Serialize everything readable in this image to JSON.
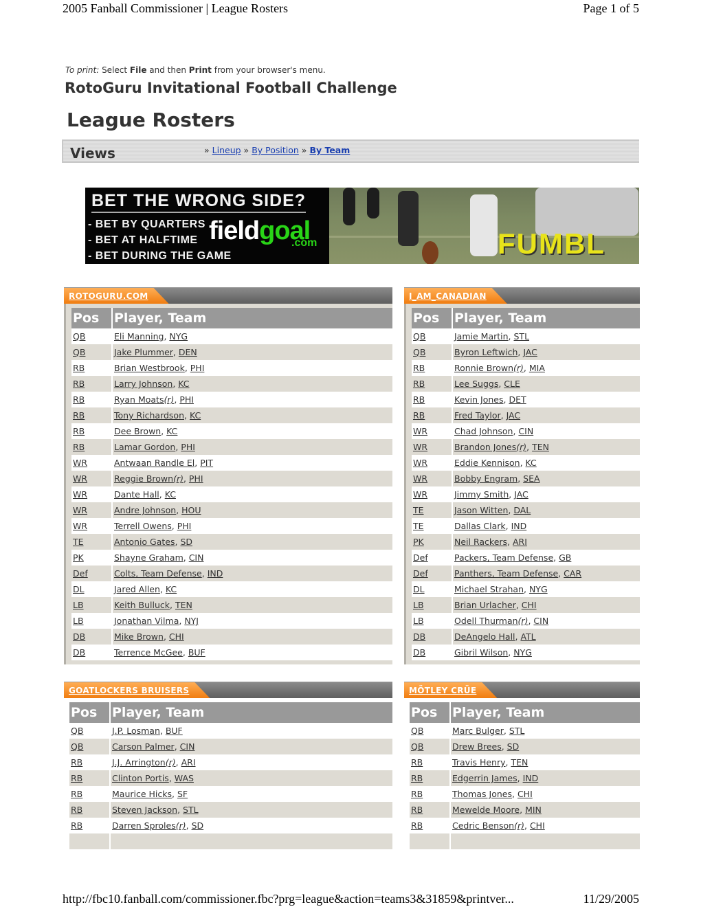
{
  "print_header": {
    "title": "2005 Fanball Commissioner | League Rosters",
    "page": "Page 1 of 5"
  },
  "print_footer": {
    "url": "http://fbc10.fanball.com/commissioner.fbc?prg=league&action=teams3&31859&printver...",
    "date": "11/29/2005"
  },
  "instructions": {
    "prefix": "To print:",
    "t1": " Select ",
    "file": "File",
    "t2": " and then ",
    "print": "Print",
    "t3": " from your browser's menu."
  },
  "league_name": "RotoGuru Invitational Football Challenge",
  "page_title": "League Rosters",
  "views": {
    "label": "Views",
    "sep": "»",
    "links": [
      {
        "label": "Lineup",
        "active": false
      },
      {
        "label": "By Position",
        "active": false
      },
      {
        "label": "By Team",
        "active": true
      }
    ]
  },
  "banner": {
    "headline": "BET THE WRONG SIDE?",
    "bullets": [
      "- BET BY QUARTERS",
      "- BET AT HALFTIME",
      "- BET DURING THE GAME"
    ],
    "logo_a": "field",
    "logo_b": "goal",
    "logo_c": ".com",
    "overlay": "FUMBL"
  },
  "columns": {
    "pos": "Pos",
    "player": "Player, Team"
  },
  "rookie_mark": "(r)",
  "teams": [
    {
      "name": "ROTOGURU.COM",
      "players": [
        {
          "pos": "QB",
          "name": "Eli Manning",
          "team": "NYG",
          "rookie": false
        },
        {
          "pos": "QB",
          "name": "Jake Plummer",
          "team": "DEN",
          "rookie": false
        },
        {
          "pos": "RB",
          "name": "Brian Westbrook",
          "team": "PHI",
          "rookie": false
        },
        {
          "pos": "RB",
          "name": "Larry Johnson",
          "team": "KC",
          "rookie": false
        },
        {
          "pos": "RB",
          "name": "Ryan Moats",
          "team": "PHI",
          "rookie": true
        },
        {
          "pos": "RB",
          "name": "Tony Richardson",
          "team": "KC",
          "rookie": false
        },
        {
          "pos": "RB",
          "name": "Dee Brown",
          "team": "KC",
          "rookie": false
        },
        {
          "pos": "RB",
          "name": "Lamar Gordon",
          "team": "PHI",
          "rookie": false
        },
        {
          "pos": "WR",
          "name": "Antwaan Randle El",
          "team": "PIT",
          "rookie": false
        },
        {
          "pos": "WR",
          "name": "Reggie Brown",
          "team": "PHI",
          "rookie": true
        },
        {
          "pos": "WR",
          "name": "Dante Hall",
          "team": "KC",
          "rookie": false
        },
        {
          "pos": "WR",
          "name": "Andre Johnson",
          "team": "HOU",
          "rookie": false
        },
        {
          "pos": "WR",
          "name": "Terrell Owens",
          "team": "PHI",
          "rookie": false
        },
        {
          "pos": "TE",
          "name": "Antonio Gates",
          "team": "SD",
          "rookie": false
        },
        {
          "pos": "PK",
          "name": "Shayne Graham",
          "team": "CIN",
          "rookie": false
        },
        {
          "pos": "Def",
          "name": "Colts, Team Defense",
          "team": "IND",
          "rookie": false
        },
        {
          "pos": "DL",
          "name": "Jared Allen",
          "team": "KC",
          "rookie": false
        },
        {
          "pos": "LB",
          "name": "Keith Bulluck",
          "team": "TEN",
          "rookie": false
        },
        {
          "pos": "LB",
          "name": "Jonathan Vilma",
          "team": "NYJ",
          "rookie": false
        },
        {
          "pos": "DB",
          "name": "Mike Brown",
          "team": "CHI",
          "rookie": false
        },
        {
          "pos": "DB",
          "name": "Terrence McGee",
          "team": "BUF",
          "rookie": false
        }
      ]
    },
    {
      "name": "I_AM_CANADIAN",
      "players": [
        {
          "pos": "QB",
          "name": "Jamie Martin",
          "team": "STL",
          "rookie": false
        },
        {
          "pos": "QB",
          "name": "Byron Leftwich",
          "team": "JAC",
          "rookie": false
        },
        {
          "pos": "RB",
          "name": "Ronnie Brown",
          "team": "MIA",
          "rookie": true
        },
        {
          "pos": "RB",
          "name": "Lee Suggs",
          "team": "CLE",
          "rookie": false
        },
        {
          "pos": "RB",
          "name": "Kevin Jones",
          "team": "DET",
          "rookie": false
        },
        {
          "pos": "RB",
          "name": "Fred Taylor",
          "team": "JAC",
          "rookie": false
        },
        {
          "pos": "WR",
          "name": "Chad Johnson",
          "team": "CIN",
          "rookie": false
        },
        {
          "pos": "WR",
          "name": "Brandon Jones",
          "team": "TEN",
          "rookie": true
        },
        {
          "pos": "WR",
          "name": "Eddie Kennison",
          "team": "KC",
          "rookie": false
        },
        {
          "pos": "WR",
          "name": "Bobby Engram",
          "team": "SEA",
          "rookie": false
        },
        {
          "pos": "WR",
          "name": "Jimmy Smith",
          "team": "JAC",
          "rookie": false
        },
        {
          "pos": "TE",
          "name": "Jason Witten",
          "team": "DAL",
          "rookie": false
        },
        {
          "pos": "TE",
          "name": "Dallas Clark",
          "team": "IND",
          "rookie": false
        },
        {
          "pos": "PK",
          "name": "Neil Rackers",
          "team": "ARI",
          "rookie": false
        },
        {
          "pos": "Def",
          "name": "Packers, Team Defense",
          "team": "GB",
          "rookie": false
        },
        {
          "pos": "Def",
          "name": "Panthers, Team Defense",
          "team": "CAR",
          "rookie": false
        },
        {
          "pos": "DL",
          "name": "Michael Strahan",
          "team": "NYG",
          "rookie": false
        },
        {
          "pos": "LB",
          "name": "Brian Urlacher",
          "team": "CHI",
          "rookie": false
        },
        {
          "pos": "LB",
          "name": "Odell Thurman",
          "team": "CIN",
          "rookie": true
        },
        {
          "pos": "DB",
          "name": "DeAngelo Hall",
          "team": "ATL",
          "rookie": false
        },
        {
          "pos": "DB",
          "name": "Gibril Wilson",
          "team": "NYG",
          "rookie": false
        }
      ]
    },
    {
      "name": "GOATLOCKERS BRUISERS",
      "players": [
        {
          "pos": "QB",
          "name": "J.P. Losman",
          "team": "BUF",
          "rookie": false
        },
        {
          "pos": "QB",
          "name": "Carson Palmer",
          "team": "CIN",
          "rookie": false
        },
        {
          "pos": "RB",
          "name": "J.J. Arrington",
          "team": "ARI",
          "rookie": true
        },
        {
          "pos": "RB",
          "name": "Clinton Portis",
          "team": "WAS",
          "rookie": false
        },
        {
          "pos": "RB",
          "name": "Maurice Hicks",
          "team": "SF",
          "rookie": false
        },
        {
          "pos": "RB",
          "name": "Steven Jackson",
          "team": "STL",
          "rookie": false
        },
        {
          "pos": "RB",
          "name": "Darren Sproles",
          "team": "SD",
          "rookie": true
        },
        {
          "pos": "",
          "name": "",
          "team": "",
          "rookie": false
        }
      ]
    },
    {
      "name": "MÖTLEY CRÜE",
      "players": [
        {
          "pos": "QB",
          "name": "Marc Bulger",
          "team": "STL",
          "rookie": false
        },
        {
          "pos": "QB",
          "name": "Drew Brees",
          "team": "SD",
          "rookie": false
        },
        {
          "pos": "RB",
          "name": "Travis Henry",
          "team": "TEN",
          "rookie": false
        },
        {
          "pos": "RB",
          "name": "Edgerrin James",
          "team": "IND",
          "rookie": false
        },
        {
          "pos": "RB",
          "name": "Thomas Jones",
          "team": "CHI",
          "rookie": false
        },
        {
          "pos": "RB",
          "name": "Mewelde Moore",
          "team": "MIN",
          "rookie": false
        },
        {
          "pos": "RB",
          "name": "Cedric Benson",
          "team": "CHI",
          "rookie": true
        },
        {
          "pos": "",
          "name": "",
          "team": "",
          "rookie": false
        }
      ]
    }
  ]
}
